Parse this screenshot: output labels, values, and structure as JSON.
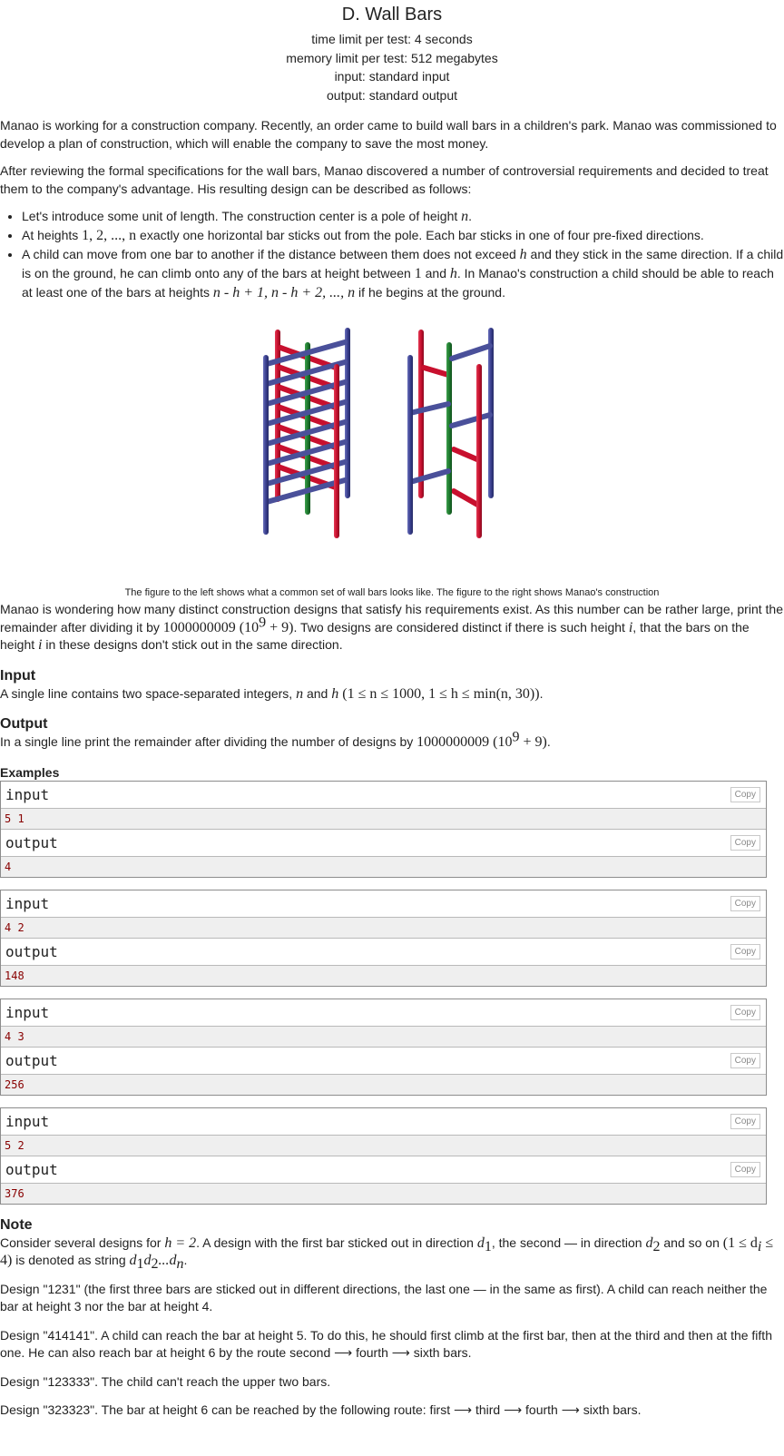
{
  "problem": {
    "title": "D. Wall Bars",
    "time_limit": "time limit per test: 4 seconds",
    "memory_limit": "memory limit per test: 512 megabytes",
    "input_file": "input: standard input",
    "output_file": "output: standard output"
  },
  "statement": {
    "p1": "Manao is working for a construction company. Recently, an order came to build wall bars in a children's park. Manao was commissioned to develop a plan of construction, which will enable the company to save the most money.",
    "p2": "After reviewing the formal specifications for the wall bars, Manao discovered a number of controversial requirements and decided to treat them to the company's advantage. His resulting design can be described as follows:",
    "b1a": "Let's introduce some unit of length. The construction center is a pole of height ",
    "b1m": "n",
    "b1b": ".",
    "b2a": "At heights ",
    "b2m": "1, 2, ..., n",
    "b2b": " exactly one horizontal bar sticks out from the pole. Each bar sticks in one of four pre-fixed directions.",
    "b3a": "A child can move from one bar to another if the distance between them does not exceed ",
    "b3m1": "h",
    "b3b": " and they stick in the same direction. If a child is on the ground, he can climb onto any of the bars at height between ",
    "b3m2": "1",
    "b3c": " and ",
    "b3m3": "h",
    "b3d": ". In Manao's construction a child should be able to reach at least one of the bars at heights ",
    "b3m4": "n - h + 1, n - h + 2, ..., n",
    "b3e": " if he begins at the ground.",
    "caption": "The figure to the left shows what a common set of wall bars looks like. The figure to the right shows Manao's construction",
    "p3a": "Manao is wondering how many distinct construction designs that satisfy his requirements exist. As this number can be rather large, print the remainder after dividing it by ",
    "p3m": "1000000009 (10",
    "p3sup": "9",
    "p3m2": " + 9)",
    "p3b": ". Two designs are considered distinct if there is such height ",
    "p3i": "i",
    "p3c": ", that the bars on the height ",
    "p3i2": "i",
    "p3d": " in these designs don't stick out in the same direction."
  },
  "input_section": {
    "title": "Input",
    "text_a": "A single line contains two space-separated integers, ",
    "m1": "n",
    "text_b": " and ",
    "m2": "h",
    "m3": " (1 ≤ n ≤ 1000, 1 ≤ h ≤ min(n, 30))",
    "text_c": "."
  },
  "output_section": {
    "title": "Output",
    "text_a": "In a single line print the remainder after dividing the number of designs by ",
    "m1": "1000000009 (10",
    "sup": "9",
    "m2": " + 9)",
    "text_b": "."
  },
  "examples": {
    "title": "Examples",
    "input_label": "input",
    "output_label": "output",
    "copy_label": "Copy",
    "items": [
      {
        "input": "5 1",
        "output": "4"
      },
      {
        "input": "4 2",
        "output": "148"
      },
      {
        "input": "4 3",
        "output": "256"
      },
      {
        "input": "5 2",
        "output": "376"
      }
    ]
  },
  "note": {
    "title": "Note",
    "p1a": "Consider several designs for ",
    "p1m": "h = 2",
    "p1b": ". A design with the first bar sticked out in direction ",
    "p1d1": "d",
    "p1s1": "1",
    "p1c": ", the second — in direction ",
    "p1d2": "d",
    "p1s2": "2",
    "p1d": " and so on ",
    "p1m2a": "(1 ≤ d",
    "p1m2s": "i",
    "p1m2b": " ≤ 4)",
    "p1e": " is denoted as string ",
    "p1m3": "d",
    "p1m3s1": "1",
    "p1m3b": "d",
    "p1m3s2": "2",
    "p1m3c": "...d",
    "p1m3s3": "n",
    "p1f": ".",
    "p2": "Design \"1231\" (the first three bars are sticked out in different directions, the last one — in the same as first). A child can reach neither the bar at height 3 nor the bar at height 4.",
    "p3": "Design \"414141\". A child can reach the bar at height 5. To do this, he should first climb at the first bar, then at the third and then at the fifth one. He can also reach bar at height 6 by the route second  ⟶  fourth  ⟶  sixth bars.",
    "p4": "Design \"123333\". The child can't reach the upper two bars.",
    "p5": "Design \"323323\". The bar at height 6 can be reached by the following route: first  ⟶  third  ⟶  fourth  ⟶  sixth bars."
  },
  "colors": {
    "pole_red": "#c8102e",
    "pole_green": "#1e7a2e",
    "pole_blue": "#3a3f8f",
    "bar_blue": "#4a509a"
  }
}
